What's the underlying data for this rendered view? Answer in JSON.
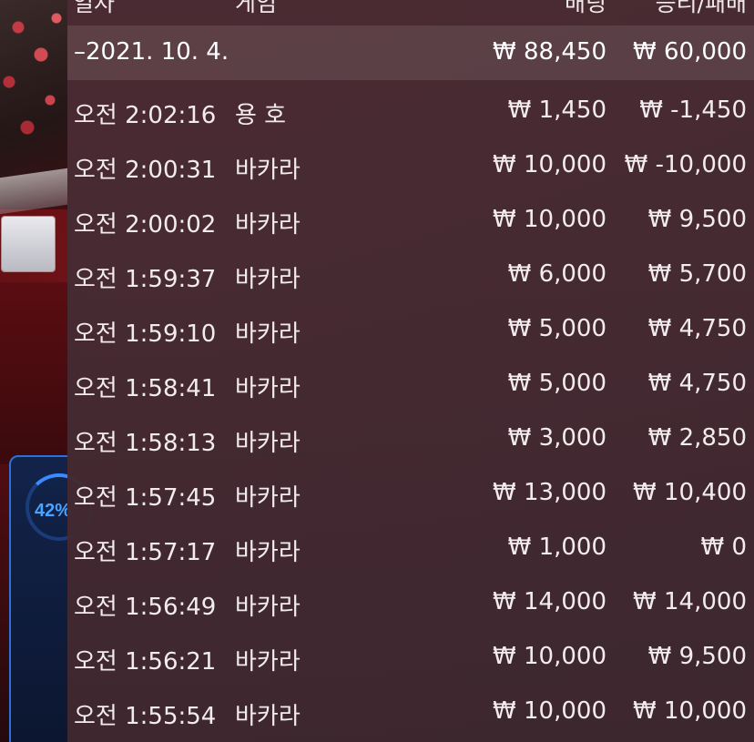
{
  "header": {
    "date_label": "일자",
    "game_label": "게임",
    "bet_label": "배팅",
    "win_label": "승리/패배"
  },
  "background": {
    "gauge_label": "42%"
  },
  "group": {
    "date": "–2021. 10. 4.",
    "bet": "₩ 88,450",
    "win": "₩ 60,000"
  },
  "rows": [
    {
      "time": "오전 2:02:16",
      "game": "용 호",
      "bet": "₩ 1,450",
      "win": "₩ -1,450"
    },
    {
      "time": "오전 2:00:31",
      "game": "바카라",
      "bet": "₩ 10,000",
      "win": "₩ -10,000"
    },
    {
      "time": "오전 2:00:02",
      "game": "바카라",
      "bet": "₩ 10,000",
      "win": "₩ 9,500"
    },
    {
      "time": "오전 1:59:37",
      "game": "바카라",
      "bet": "₩ 6,000",
      "win": "₩ 5,700"
    },
    {
      "time": "오전 1:59:10",
      "game": "바카라",
      "bet": "₩ 5,000",
      "win": "₩ 4,750"
    },
    {
      "time": "오전 1:58:41",
      "game": "바카라",
      "bet": "₩ 5,000",
      "win": "₩ 4,750"
    },
    {
      "time": "오전 1:58:13",
      "game": "바카라",
      "bet": "₩ 3,000",
      "win": "₩ 2,850"
    },
    {
      "time": "오전 1:57:45",
      "game": "바카라",
      "bet": "₩ 13,000",
      "win": "₩ 10,400"
    },
    {
      "time": "오전 1:57:17",
      "game": "바카라",
      "bet": "₩ 1,000",
      "win": "₩ 0"
    },
    {
      "time": "오전 1:56:49",
      "game": "바카라",
      "bet": "₩ 14,000",
      "win": "₩ 14,000"
    },
    {
      "time": "오전 1:56:21",
      "game": "바카라",
      "bet": "₩ 10,000",
      "win": "₩ 9,500"
    },
    {
      "time": "오전 1:55:54",
      "game": "바카라",
      "bet": "₩ 10,000",
      "win": "₩ 10,000"
    }
  ]
}
